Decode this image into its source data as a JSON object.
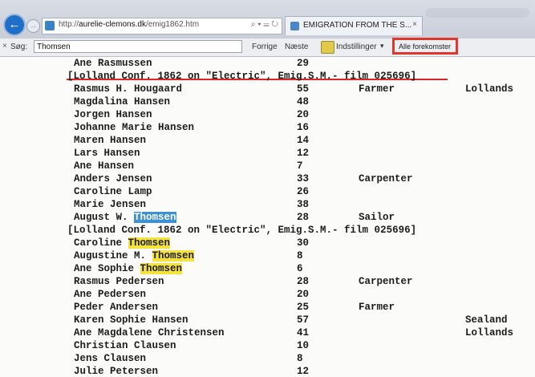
{
  "browser": {
    "back_icon": "back-arrow-icon",
    "forward_icon": "forward-arrow-icon",
    "url_prefix": "http://",
    "url_host": "aurelie-clemons.dk",
    "url_path": "/emig1862.htm",
    "address_tools": "⌕ ▾ ☰ ↻",
    "tab_title": "EMIGRATION FROM THE S...",
    "tab_close": "×"
  },
  "findbar": {
    "close": "×",
    "label": "Søg:",
    "query": "Thomsen",
    "prev": "Forrige",
    "next": "Næste",
    "options": "Indstillinger",
    "options_caret": "▾",
    "highlight_all": "Alle forekomster"
  },
  "emigrants": [
    {
      "name": "Ane Rasmussen",
      "age": "29",
      "occupation": "",
      "region": ""
    },
    {
      "header": "[Lolland Conf. 1862 on \"Electric\", Emig.S.M.- film 025696]"
    },
    {
      "name": "Rasmus H. Hougaard",
      "age": "55",
      "occupation": "Farmer",
      "region": "Lollands"
    },
    {
      "name": "Magdalina Hansen",
      "age": "48",
      "occupation": "",
      "region": ""
    },
    {
      "name": "Jorgen Hansen",
      "age": "20",
      "occupation": "",
      "region": ""
    },
    {
      "name": "Johanne Marie Hansen",
      "age": "16",
      "occupation": "",
      "region": ""
    },
    {
      "name": "Maren Hansen",
      "age": "14",
      "occupation": "",
      "region": ""
    },
    {
      "name": "Lars Hansen",
      "age": "12",
      "occupation": "",
      "region": ""
    },
    {
      "name": "Ane Hansen",
      "age": "7",
      "occupation": "",
      "region": ""
    },
    {
      "name": "Anders Jensen",
      "age": "33",
      "occupation": "Carpenter",
      "region": ""
    },
    {
      "name": "Caroline Lamp",
      "age": "26",
      "occupation": "",
      "region": ""
    },
    {
      "name": "Marie Jensen",
      "age": "38",
      "occupation": "",
      "region": ""
    },
    {
      "name": "August W. Thomsen",
      "age": "28",
      "occupation": "Sailor",
      "region": "",
      "hl": "current"
    },
    {
      "header": "[Lolland Conf. 1862 on \"Electric\", Emig.S.M.- film 025696]"
    },
    {
      "name": "Caroline Thomsen",
      "age": "30",
      "occupation": "",
      "region": "",
      "hl": "match"
    },
    {
      "name": "Augustine M. Thomsen",
      "age": "8",
      "occupation": "",
      "region": "",
      "hl": "match"
    },
    {
      "name": "Ane Sophie Thomsen",
      "age": "6",
      "occupation": "",
      "region": "",
      "hl": "match"
    },
    {
      "name": "Rasmus Pedersen",
      "age": "28",
      "occupation": "Carpenter",
      "region": ""
    },
    {
      "name": "Ane Pedersen",
      "age": "20",
      "occupation": "",
      "region": ""
    },
    {
      "name": "Peder Andersen",
      "age": "25",
      "occupation": "Farmer",
      "region": ""
    },
    {
      "name": "Karen Sophie Hansen",
      "age": "57",
      "occupation": "",
      "region": "Sealand"
    },
    {
      "name": "Ane Magdalene Christensen",
      "age": "41",
      "occupation": "",
      "region": "Lollands"
    },
    {
      "name": "Christian Clausen",
      "age": "10",
      "occupation": "",
      "region": ""
    },
    {
      "name": "Jens Clausen",
      "age": "8",
      "occupation": "",
      "region": ""
    },
    {
      "name": "Julie Petersen",
      "age": "12",
      "occupation": "",
      "region": ""
    }
  ],
  "colors": {
    "match_highlight": "#f5e23c",
    "current_highlight": "#3d8fd6",
    "annotation_red": "#e2352b"
  }
}
